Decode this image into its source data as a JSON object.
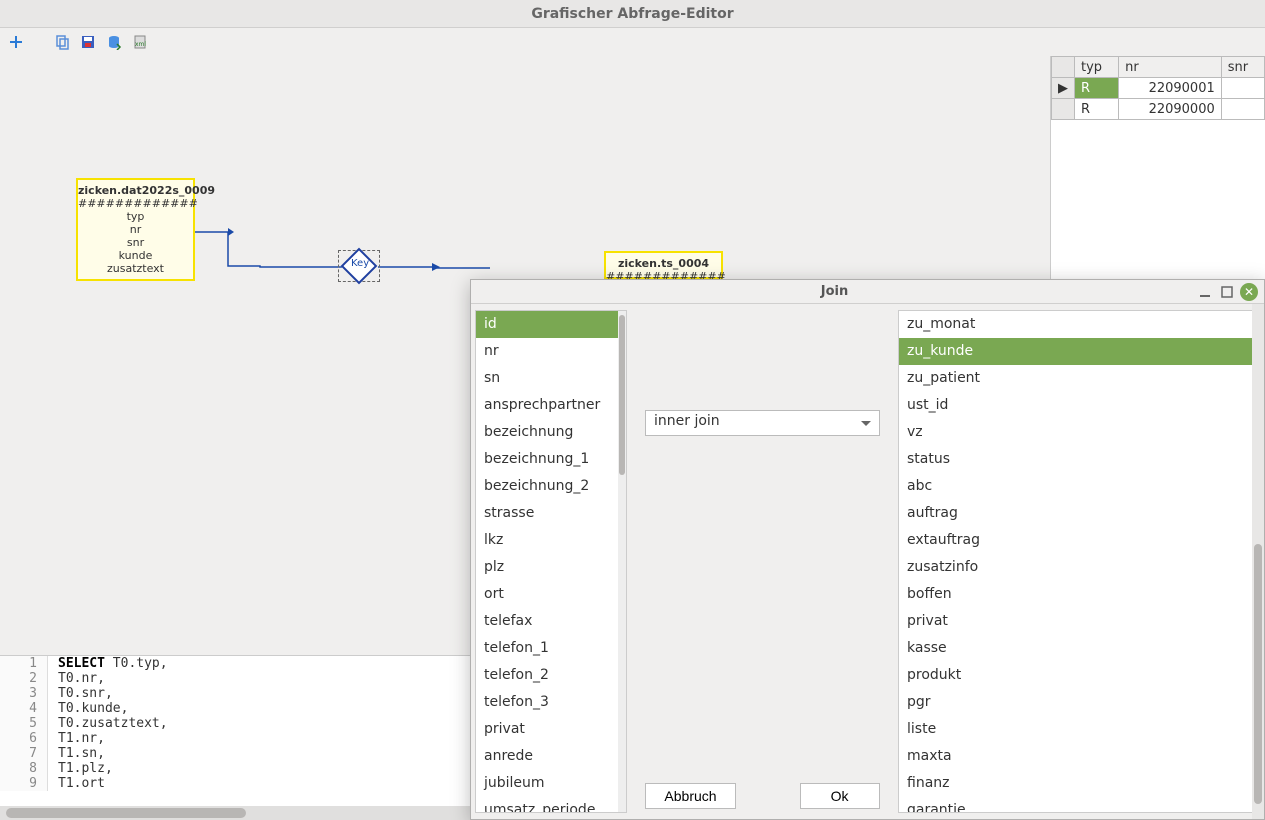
{
  "window": {
    "title": "Grafischer Abfrage-Editor"
  },
  "toolbar": {
    "icons": [
      "add",
      "copy",
      "save",
      "export-db",
      "export-xml"
    ]
  },
  "entities": {
    "left": {
      "name": "zicken.dat2022s_0009",
      "hash": "#############",
      "fields": [
        "typ",
        "nr",
        "snr",
        "kunde",
        "zusatztext"
      ]
    },
    "right": {
      "name": "zicken.ts_0004",
      "hash": "#############"
    },
    "key_label": "Key"
  },
  "results": {
    "headers": [
      "typ",
      "nr",
      "snr"
    ],
    "rows": [
      {
        "ptr": "▶",
        "typ": "R",
        "nr": "22090001",
        "snr": "",
        "sel": true
      },
      {
        "ptr": "",
        "typ": "R",
        "nr": "22090000",
        "snr": ""
      }
    ]
  },
  "sql": {
    "lines": [
      {
        "n": "1",
        "pre": "SELECT ",
        "rest": "T0.typ,"
      },
      {
        "n": "2",
        "pre": "",
        "rest": "T0.nr,"
      },
      {
        "n": "3",
        "pre": "",
        "rest": "T0.snr,"
      },
      {
        "n": "4",
        "pre": "",
        "rest": "T0.kunde,"
      },
      {
        "n": "5",
        "pre": "",
        "rest": "T0.zusatztext,"
      },
      {
        "n": "6",
        "pre": "",
        "rest": "T1.nr,"
      },
      {
        "n": "7",
        "pre": "",
        "rest": "T1.sn,"
      },
      {
        "n": "8",
        "pre": "",
        "rest": "T1.plz,"
      },
      {
        "n": "9",
        "pre": "",
        "rest": "T1.ort"
      }
    ]
  },
  "join_dialog": {
    "title": "Join",
    "join_type": "inner join",
    "buttons": {
      "cancel": "Abbruch",
      "ok": "Ok"
    },
    "left_fields": [
      "id",
      "nr",
      "sn",
      "ansprechpartner",
      "bezeichnung",
      "bezeichnung_1",
      "bezeichnung_2",
      "strasse",
      "lkz",
      "plz",
      "ort",
      "telefax",
      "telefon_1",
      "telefon_2",
      "telefon_3",
      "privat",
      "anrede",
      "jubileum",
      "umsatz_periode"
    ],
    "left_selected": "id",
    "right_fields": [
      "zu_monat",
      "zu_kunde",
      "zu_patient",
      "ust_id",
      "vz",
      "status",
      "abc",
      "auftrag",
      "extauftrag",
      "zusatzinfo",
      "boffen",
      "privat",
      "kasse",
      "produkt",
      "pgr",
      "liste",
      "maxta",
      "finanz",
      "garantie"
    ],
    "right_selected": "zu_kunde"
  }
}
